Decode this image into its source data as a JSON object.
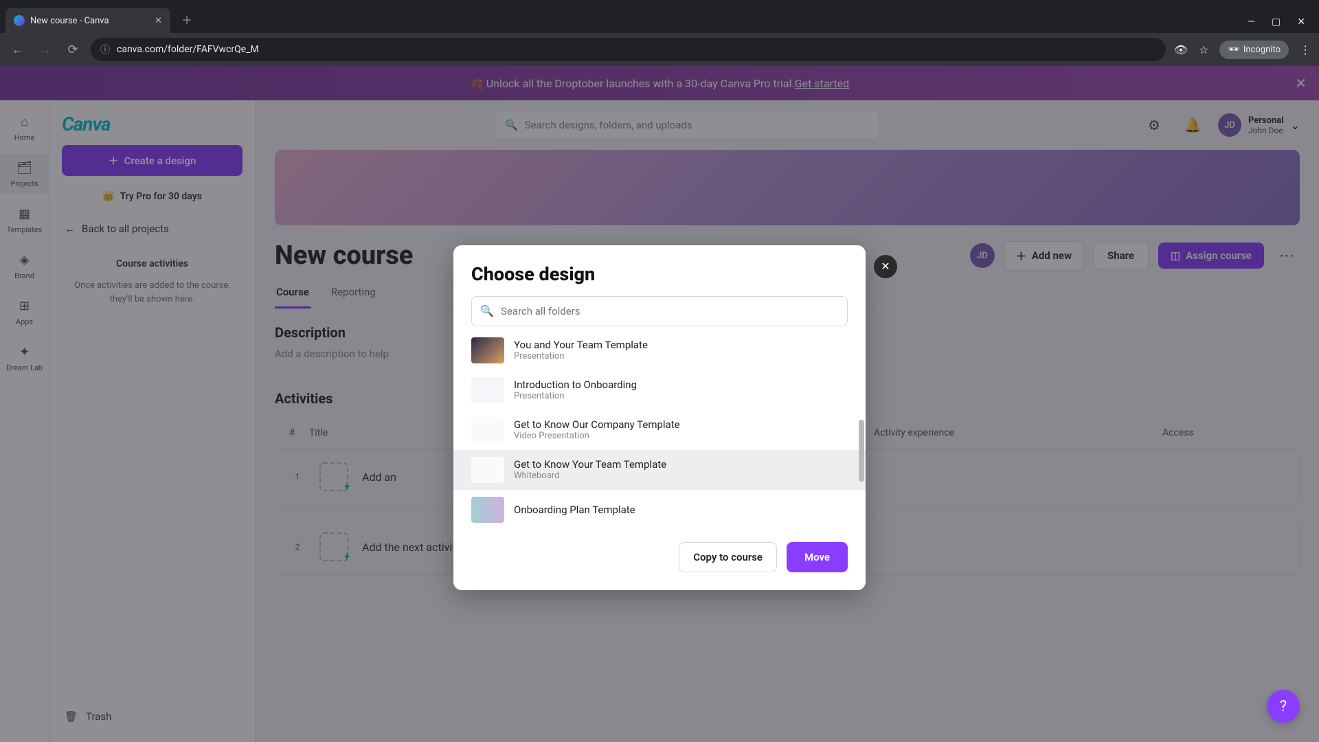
{
  "browser": {
    "tab_title": "New course - Canva",
    "url": "canva.com/folder/FAFVwcrQe_M",
    "incognito_label": "Incognito"
  },
  "banner": {
    "text": "🍂 Unlock all the Droptober launches with a 30-day Canva Pro trial. ",
    "link": "Get started"
  },
  "rail": {
    "items": [
      {
        "label": "Home",
        "icon": "⌂"
      },
      {
        "label": "Projects",
        "icon": "🗂"
      },
      {
        "label": "Templates",
        "icon": "▦"
      },
      {
        "label": "Brand",
        "icon": "◈"
      },
      {
        "label": "Apps",
        "icon": "⊞"
      },
      {
        "label": "Dream Lab",
        "icon": "✦"
      }
    ]
  },
  "sidebar": {
    "logo": "Canva",
    "create_label": "Create a design",
    "try_pro_label": "Try Pro for 30 days",
    "back_label": "Back to all projects",
    "course_activities_title": "Course activities",
    "course_activities_desc": "Once activities are added to the course, they'll be shown here.",
    "trash_label": "Trash"
  },
  "topbar": {
    "search_placeholder": "Search designs, folders, and uploads",
    "account_type": "Personal",
    "account_name": "John Doe",
    "avatar_initials": "JD"
  },
  "page": {
    "title": "New course",
    "addnew_label": "Add new",
    "share_label": "Share",
    "assign_label": "Assign course",
    "tabs": [
      "Course",
      "Reporting"
    ],
    "desc_heading": "Description",
    "desc_placeholder": "Add a description to help",
    "activities_heading": "Activities",
    "columns": {
      "num": "#",
      "title": "Title",
      "exp": "Activity experience",
      "access": "Access"
    },
    "rows": [
      {
        "num": "1",
        "text": "Add an"
      },
      {
        "num": "2",
        "text": "Add the next activity to your course"
      }
    ]
  },
  "modal": {
    "title": "Choose design",
    "search_placeholder": "Search all folders",
    "copy_label": "Copy to course",
    "move_label": "Move",
    "designs": [
      {
        "title": "You and Your Team Template",
        "type": "Presentation"
      },
      {
        "title": "Introduction to Onboarding",
        "type": "Presentation"
      },
      {
        "title": "Get to Know Our Company Template",
        "type": "Video Presentation"
      },
      {
        "title": "Get to Know Your Team Template",
        "type": "Whiteboard"
      },
      {
        "title": "Onboarding Plan Template",
        "type": ""
      }
    ]
  },
  "help": "?"
}
